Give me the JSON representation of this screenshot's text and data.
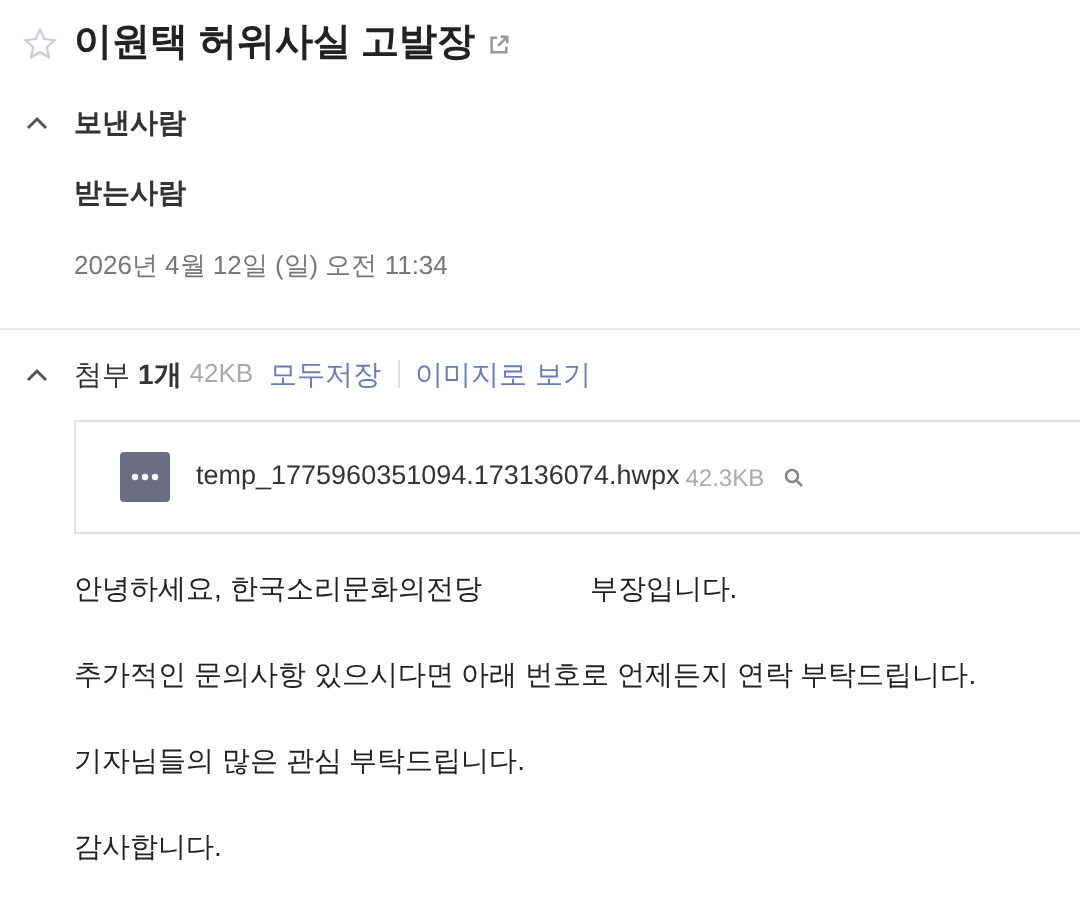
{
  "mail": {
    "title": "이원택 허위사실 고발장",
    "starred": false
  },
  "sender_section": {
    "label": "보낸사람",
    "expanded": true
  },
  "recipient_label": "받는사람",
  "date": "2026년 4월 12일 (일) 오전 11:34",
  "attachments": {
    "expanded": true,
    "label": "첨부",
    "count": "1개",
    "size": "42KB",
    "actions": [
      "모두저장",
      "이미지로 보기"
    ],
    "files": [
      {
        "name": "temp_1775960351094.173136074.hwpx",
        "size": "42.3KB"
      }
    ]
  },
  "body": [
    {
      "parts": [
        "안녕하세요, 한국소리문화의전당",
        "부장입니다."
      ]
    },
    {
      "parts": [
        "추가적인 문의사항 있으시다면 아래 번호로 언제든지 연락 부탁드립니다."
      ]
    },
    {
      "parts": [
        "기자님들의 많은 관심 부탁드립니다."
      ]
    },
    {
      "parts": [
        "감사합니다."
      ]
    }
  ]
}
